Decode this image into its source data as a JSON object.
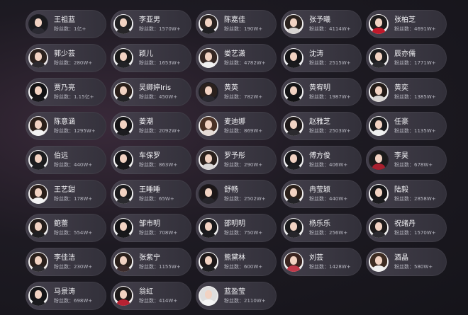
{
  "fans_label": "粉丝数：",
  "cards": [
    {
      "name": "王祖蓝",
      "fans": "1亿+",
      "bg": "#1d1d24",
      "hair": "#1a1a1d",
      "body": "#2b2a32"
    },
    {
      "name": "李亚男",
      "fans": "1570W+",
      "bg": "#ececef",
      "hair": "#202022",
      "body": "#262528"
    },
    {
      "name": "陈嘉佳",
      "fans": "190W+",
      "bg": "#e9e9ec",
      "hair": "#2a2220",
      "body": "#1f1f22"
    },
    {
      "name": "张予曦",
      "fans": "4114W+",
      "bg": "#f0eeee",
      "hair": "#2a221e",
      "body": "#d8d4d2"
    },
    {
      "name": "张柏芝",
      "fans": "4691W+",
      "bg": "#f2eeee",
      "hair": "#1d1b1c",
      "body": "#c0192b"
    },
    {
      "name": "郭少芸",
      "fans": "280W+",
      "bg": "#ebe8ea",
      "hair": "#2b211d",
      "body": "#2c2a2f"
    },
    {
      "name": "颖儿",
      "fans": "1653W+",
      "bg": "#eeeeee",
      "hair": "#1a1a1a",
      "body": "#222226"
    },
    {
      "name": "娄艺潇",
      "fans": "4782W+",
      "bg": "#eceaea",
      "hair": "#352723",
      "body": "#f1f1f1"
    },
    {
      "name": "沈涛",
      "fans": "2515W+",
      "bg": "#f1f1f3",
      "hair": "#151517",
      "body": "#1a1a1d"
    },
    {
      "name": "辰亦儒",
      "fans": "1771W+",
      "bg": "#ededee",
      "hair": "#1d1d1f",
      "body": "#2a2a2e"
    },
    {
      "name": "贾乃亮",
      "fans": "1.15亿+",
      "bg": "#f3f3f3",
      "hair": "#121214",
      "body": "#16161a"
    },
    {
      "name": "吴卿婷Iris",
      "fans": "450W+",
      "bg": "#eeeeef",
      "hair": "#2a1f1a",
      "body": "#222225"
    },
    {
      "name": "黄英",
      "fans": "782W+",
      "bg": "#1d1c21",
      "hair": "#2b211d",
      "body": "#2a2930"
    },
    {
      "name": "黄宥明",
      "fans": "1987W+",
      "bg": "#efeff0",
      "hair": "#141416",
      "body": "#121214"
    },
    {
      "name": "黄奕",
      "fans": "1385W+",
      "bg": "#ededee",
      "hair": "#231b18",
      "body": "#d9d6d4"
    },
    {
      "name": "陈意涵",
      "fans": "1295W+",
      "bg": "#eceaea",
      "hair": "#2b201a",
      "body": "#f3f3f3"
    },
    {
      "name": "姜潮",
      "fans": "2092W+",
      "bg": "#efefef",
      "hair": "#151517",
      "body": "#1c1c1f"
    },
    {
      "name": "麦迪娜",
      "fans": "869W+",
      "bg": "#f0eeec",
      "hair": "#4a3226",
      "body": "#e6dcd6"
    },
    {
      "name": "赵雅芝",
      "fans": "2503W+",
      "bg": "#f2f0f0",
      "hair": "#1f1a1a",
      "body": "#2b2a2e"
    },
    {
      "name": "任豪",
      "fans": "1135W+",
      "bg": "#eeeeee",
      "hair": "#1a1a1c",
      "body": "#f0f0f0"
    },
    {
      "name": "伯远",
      "fans": "440W+",
      "bg": "#ededee",
      "hair": "#1b1b1d",
      "body": "#1f1f23"
    },
    {
      "name": "车保罗",
      "fans": "863W+",
      "bg": "#f1f1f1",
      "hair": "#141416",
      "body": "#17171a"
    },
    {
      "name": "罗予彤",
      "fans": "290W+",
      "bg": "#efedee",
      "hair": "#2a201c",
      "body": "#d9d6d6"
    },
    {
      "name": "傅方俊",
      "fans": "406W+",
      "bg": "#efeff0",
      "hair": "#161618",
      "body": "#1d1d20"
    },
    {
      "name": "李昊",
      "fans": "678W+",
      "bg": "#1f1c20",
      "hair": "#1a1a1a",
      "body": "#a8202e"
    },
    {
      "name": "王艺甜",
      "fans": "178W+",
      "bg": "#efeded",
      "hair": "#2a1f1a",
      "body": "#f2f2f2"
    },
    {
      "name": "王睡睡",
      "fans": "65W+",
      "bg": "#eeeeef",
      "hair": "#1b1b1d",
      "body": "#2a2a2e"
    },
    {
      "name": "舒畅",
      "fans": "2502W+",
      "bg": "#1e1c22",
      "hair": "#1c1718",
      "body": "#26252b"
    },
    {
      "name": "冉莹颖",
      "fans": "440W+",
      "bg": "#f0eeee",
      "hair": "#2b201a",
      "body": "#222226"
    },
    {
      "name": "陆毅",
      "fans": "2858W+",
      "bg": "#f0f0f1",
      "hair": "#151517",
      "body": "#1b1b1e"
    },
    {
      "name": "鲍蕾",
      "fans": "554W+",
      "bg": "#eeeeee",
      "hair": "#241d1a",
      "body": "#1f1f22"
    },
    {
      "name": "邹市明",
      "fans": "708W+",
      "bg": "#efefef",
      "hair": "#141416",
      "body": "#18181b"
    },
    {
      "name": "邵明明",
      "fans": "750W+",
      "bg": "#f0f0f0",
      "hair": "#18181a",
      "body": "#1c1c1f"
    },
    {
      "name": "杨乐乐",
      "fans": "256W+",
      "bg": "#eeeeee",
      "hair": "#1b1b1d",
      "body": "#26252a"
    },
    {
      "name": "祝绪丹",
      "fans": "1570W+",
      "bg": "#ededed",
      "hair": "#1d1a1a",
      "body": "#2c2b30"
    },
    {
      "name": "李佳洁",
      "fans": "230W+",
      "bg": "#efedec",
      "hair": "#2a201c",
      "body": "#2b2a2e"
    },
    {
      "name": "张紫宁",
      "fans": "1155W+",
      "bg": "#eeeeee",
      "hair": "#2a201b",
      "body": "#3a2a2a"
    },
    {
      "name": "熊黛林",
      "fans": "600W+",
      "bg": "#f1f1f1",
      "hair": "#1d1819",
      "body": "#1f1f22"
    },
    {
      "name": "刘芸",
      "fans": "1428W+",
      "bg": "#efeeee",
      "hair": "#3a2420",
      "body": "#c0394a"
    },
    {
      "name": "酒晶",
      "fans": "580W+",
      "bg": "#f0eeee",
      "hair": "#3d2c22",
      "body": "#efefef"
    },
    {
      "name": "马景涛",
      "fans": "698W+",
      "bg": "#efefef",
      "hair": "#151517",
      "body": "#1a1a1d"
    },
    {
      "name": "翁虹",
      "fans": "414W+",
      "bg": "#f0eded",
      "hair": "#1e1a1a",
      "body": "#b82232"
    },
    {
      "name": "蓝盈莹",
      "fans": "2110W+",
      "bg": "#efefef",
      "hair": "#dedede",
      "body": "#f5f5f5"
    }
  ]
}
